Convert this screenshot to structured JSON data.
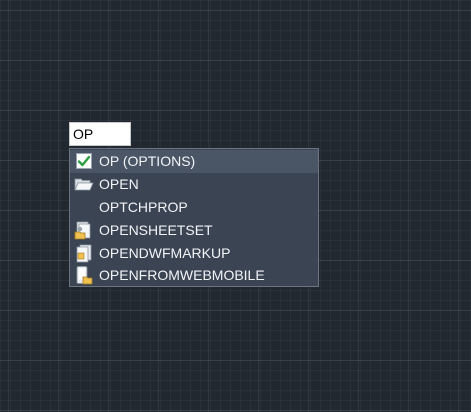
{
  "command_line": {
    "value": "OP"
  },
  "suggestions": [
    {
      "label": "OP (OPTIONS)",
      "icon": "checkbox-checked-icon",
      "selected": true
    },
    {
      "label": "OPEN",
      "icon": "folder-open-icon",
      "selected": false
    },
    {
      "label": "OPTCHPROP",
      "icon": "",
      "selected": false
    },
    {
      "label": "OPENSHEETSET",
      "icon": "sheet-set-icon",
      "selected": false
    },
    {
      "label": "OPENDWFMARKUP",
      "icon": "dwf-markup-icon",
      "selected": false
    },
    {
      "label": "OPENFROMWEBMOBILE",
      "icon": "web-mobile-icon",
      "selected": false
    }
  ],
  "colors": {
    "canvas": "#212830",
    "list_bg": "#3b4453",
    "selected_bg": "#4a5566",
    "text": "#f2f4f7",
    "check": "#2ea043",
    "folder": "#f0c050"
  }
}
